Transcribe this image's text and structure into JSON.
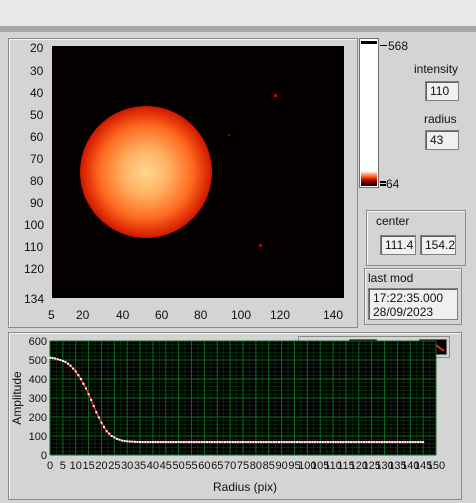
{
  "image_graph": {
    "y_ticks": [
      "20",
      "30",
      "40",
      "50",
      "60",
      "70",
      "80",
      "90",
      "100",
      "110",
      "120",
      "134"
    ],
    "x_ticks": [
      "5",
      "20",
      "40",
      "60",
      "80",
      "100",
      "120",
      "140"
    ]
  },
  "color_scale": {
    "max_label": "568",
    "min_label": "64"
  },
  "controls": {
    "intensity_label": "intensity",
    "intensity_value": "110",
    "radius_label": "radius",
    "radius_value": "43",
    "center_label": "center",
    "center_x": "111.4",
    "center_y": "154.2",
    "last_mod_label": "last mod",
    "last_mod_time": "17:22:35.000",
    "last_mod_date": "28/09/2023"
  },
  "chart_data": {
    "type": "scatter",
    "xlabel": "Radius (pix)",
    "ylabel": "Amplitude",
    "xlim": [
      0,
      150
    ],
    "ylim": [
      0,
      600
    ],
    "x_ticks": [
      "0",
      "5",
      "10",
      "15",
      "20",
      "25",
      "30",
      "35",
      "40",
      "45",
      "50",
      "55",
      "60",
      "65",
      "70",
      "75",
      "80",
      "85",
      "90",
      "95",
      "100",
      "105",
      "110",
      "115",
      "120",
      "125",
      "130",
      "135",
      "140",
      "145",
      "150"
    ],
    "y_ticks": [
      "0",
      "100",
      "200",
      "300",
      "400",
      "500",
      "600"
    ],
    "legend": {
      "placement": "top-right",
      "data_label": "Data",
      "fit_label": "Fit"
    },
    "series": [
      {
        "name": "Data",
        "x": [
          0,
          2,
          4,
          6,
          8,
          10,
          12,
          14,
          16,
          18,
          20,
          22,
          24,
          26,
          28,
          30,
          32,
          34,
          36,
          40,
          50,
          60,
          70,
          80,
          90,
          100,
          110,
          120,
          130,
          140,
          145
        ],
        "y": [
          512,
          508,
          500,
          490,
          470,
          440,
          400,
          350,
          290,
          225,
          170,
          125,
          100,
          85,
          76,
          72,
          70,
          69,
          68,
          68,
          68,
          68,
          68,
          68,
          68,
          68,
          68,
          68,
          68,
          68,
          68
        ]
      },
      {
        "name": "Fit",
        "x": [
          0,
          2,
          4,
          6,
          8,
          10,
          12,
          14,
          16,
          18,
          20,
          22,
          24,
          26,
          28,
          30,
          32,
          34,
          36,
          40,
          50,
          60,
          70,
          80,
          90,
          100,
          110,
          120,
          130,
          140,
          145
        ],
        "y": [
          512,
          508,
          500,
          490,
          470,
          440,
          400,
          350,
          290,
          225,
          170,
          125,
          100,
          85,
          76,
          72,
          70,
          69,
          68,
          68,
          68,
          68,
          68,
          68,
          68,
          68,
          68,
          68,
          68,
          68,
          68
        ]
      }
    ],
    "grid": true,
    "colors": {
      "plot_bg": "#000000",
      "grid": "#0f6b1e",
      "data": "#ffffff",
      "fit": "#ff2020"
    }
  }
}
